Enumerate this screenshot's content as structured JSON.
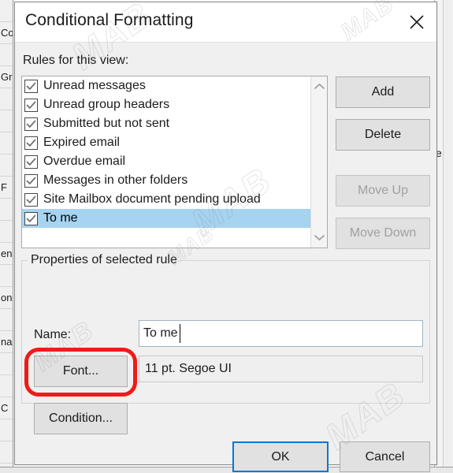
{
  "background": {
    "left_rows": [
      "",
      "Co",
      "",
      "Gr",
      "",
      "",
      "",
      "",
      "F",
      "",
      "",
      "en",
      "",
      "on",
      "",
      "na",
      "",
      "",
      "C",
      "",
      ""
    ],
    "right_fragment": "e"
  },
  "dialog": {
    "title": "Conditional Formatting",
    "close_icon": "close-icon",
    "rules_label": "Rules for this view:",
    "rules": [
      {
        "label": "Unread messages",
        "checked": true,
        "selected": false
      },
      {
        "label": "Unread group headers",
        "checked": true,
        "selected": false
      },
      {
        "label": "Submitted but not sent",
        "checked": true,
        "selected": false
      },
      {
        "label": "Expired email",
        "checked": true,
        "selected": false
      },
      {
        "label": "Overdue email",
        "checked": true,
        "selected": false
      },
      {
        "label": "Messages in other folders",
        "checked": true,
        "selected": false
      },
      {
        "label": "Site Mailbox document pending upload",
        "checked": true,
        "selected": false
      },
      {
        "label": "To me",
        "checked": true,
        "selected": true
      }
    ],
    "scroll_up_icon": "chevron-up-icon",
    "scroll_down_icon": "chevron-down-icon",
    "side_buttons": {
      "add": "Add",
      "delete": "Delete",
      "move_up": "Move Up",
      "move_down": "Move Down"
    },
    "properties": {
      "group_title": "Properties of selected rule",
      "name_label": "Name:",
      "name_value": "To me",
      "name_placeholder": "",
      "font_button": "Font...",
      "font_value": "11 pt. Segoe UI",
      "condition_button": "Condition..."
    },
    "footer": {
      "ok": "OK",
      "cancel": "Cancel"
    },
    "annotation": {
      "target": "font-button",
      "color": "#ee1c18"
    },
    "colors": {
      "selection": "#a6d3f0",
      "focus": "#0078d7",
      "dialog_bg": "#f0f0f0",
      "button_bg": "#e1e1e1"
    }
  },
  "watermark": {
    "text": "MAB"
  }
}
